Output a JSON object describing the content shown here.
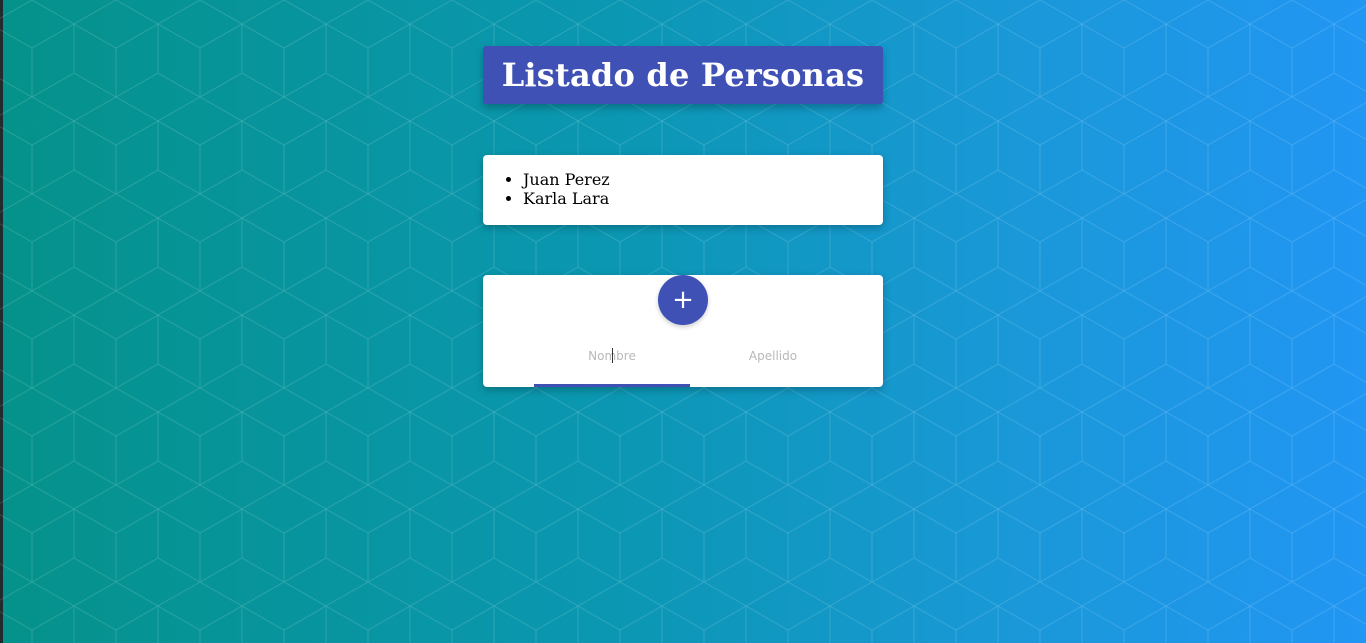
{
  "header": {
    "title": "Listado de Personas"
  },
  "people": {
    "items": [
      "Juan Perez",
      "Karla Lara"
    ]
  },
  "form": {
    "add_button_label": "+",
    "nombre_placeholder": "Nombre",
    "apellido_placeholder": "Apellido",
    "nombre_value": "",
    "apellido_value": ""
  },
  "colors": {
    "accent": "#3f51b5",
    "background_start": "#05928a",
    "background_end": "#2196f3",
    "card": "#ffffff"
  },
  "icons": {
    "add": "plus-icon"
  }
}
